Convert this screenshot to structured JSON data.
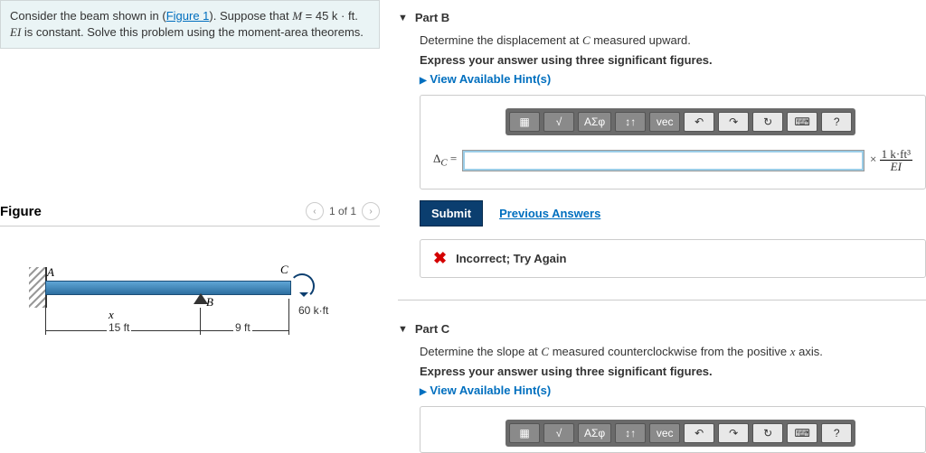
{
  "problem": {
    "text_before_link": "Consider the beam shown in (",
    "figure_link": "Figure 1",
    "text_after_link": "). Suppose that ",
    "var_M": "M",
    "eq_value": " = 45 k · ft. ",
    "var_EI": "EI",
    "text_rest": " is constant. Solve this problem using the moment-area theorems."
  },
  "figure": {
    "title": "Figure",
    "pager": "1 of 1",
    "labels": {
      "A": "A",
      "B": "B",
      "C": "C",
      "x": "x",
      "moment": "60 k·ft",
      "len1": "15 ft",
      "len2": "9 ft"
    }
  },
  "partB": {
    "title": "Part B",
    "prompt_prefix": "Determine the displacement at ",
    "prompt_var": "C",
    "prompt_suffix": " measured upward.",
    "instruction": "Express your answer using three significant figures.",
    "hints": "View Available Hint(s)",
    "toolbar": {
      "sqrt": "√",
      "greek": "ΑΣφ",
      "arrows": "↕↑",
      "vec": "vec",
      "undo": "↶",
      "redo": "↷",
      "reset": "↻",
      "kbd": "⌨",
      "help": "?"
    },
    "lhs_sym": "Δ",
    "lhs_sub": "C",
    "eq": "=",
    "unit_times": "×",
    "unit_top": "1 k·ft³",
    "unit_bot": "EI",
    "submit": "Submit",
    "prev": "Previous Answers",
    "feedback": "Incorrect; Try Again"
  },
  "partC": {
    "title": "Part C",
    "prompt_prefix": "Determine the slope at ",
    "prompt_var": "C",
    "prompt_suffix_a": " measured counterclockwise from the positive ",
    "prompt_var2": "x",
    "prompt_suffix_b": " axis.",
    "instruction": "Express your answer using three significant figures.",
    "hints": "View Available Hint(s)",
    "toolbar": {
      "sqrt": "√",
      "greek": "ΑΣφ",
      "arrows": "↕↑",
      "vec": "vec",
      "undo": "↶",
      "redo": "↷",
      "reset": "↻",
      "kbd": "⌨",
      "help": "?"
    }
  }
}
